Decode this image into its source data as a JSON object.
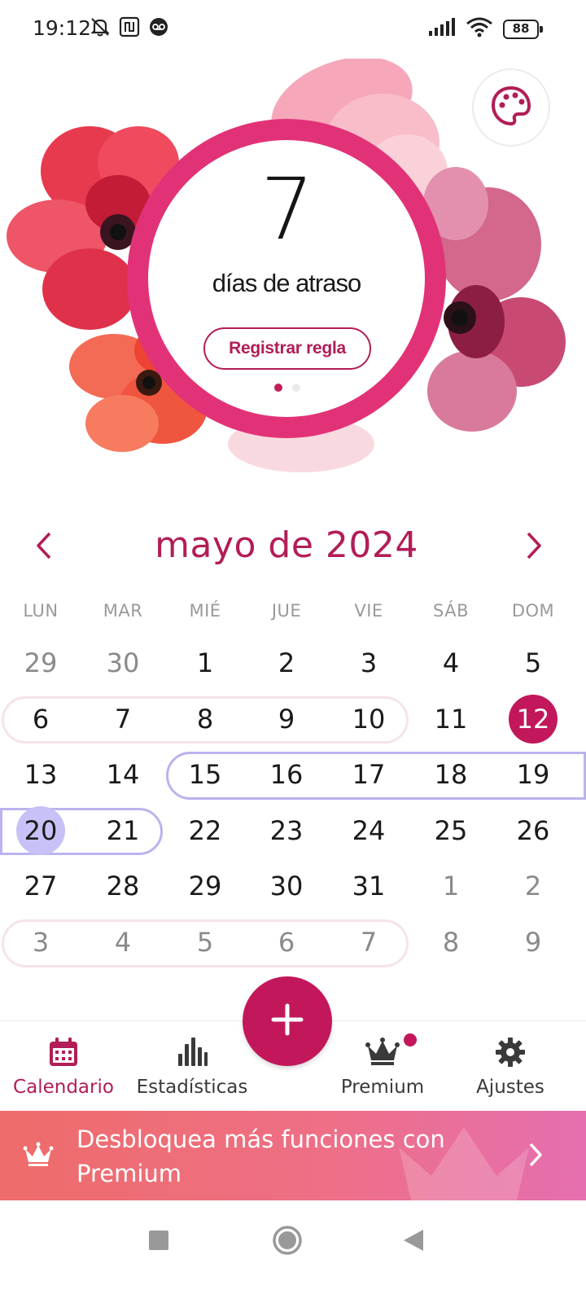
{
  "status_bar": {
    "time": "19:12",
    "battery": "88",
    "icons": [
      "muted-bell-icon",
      "nfc-icon",
      "voicemail-icon",
      "signal-icon",
      "wifi-icon",
      "battery-icon"
    ]
  },
  "hero": {
    "late_days": "7",
    "late_label": "días de atraso",
    "register_button": "Registrar regla",
    "page_count": 2,
    "active_page": 1,
    "ring_color": "#e23277"
  },
  "calendar": {
    "month_title": "mayo de 2024",
    "weekdays": [
      "LUN",
      "MAR",
      "MIÉ",
      "JUE",
      "VIE",
      "SÁB",
      "DOM"
    ],
    "weeks": [
      [
        "29",
        "30",
        "1",
        "2",
        "3",
        "4",
        "5"
      ],
      [
        "6",
        "7",
        "8",
        "9",
        "10",
        "11",
        "12"
      ],
      [
        "13",
        "14",
        "15",
        "16",
        "17",
        "18",
        "19"
      ],
      [
        "20",
        "21",
        "22",
        "23",
        "24",
        "25",
        "26"
      ],
      [
        "27",
        "28",
        "29",
        "30",
        "31",
        "1",
        "2"
      ],
      [
        "3",
        "4",
        "5",
        "6",
        "7",
        "8",
        "9"
      ]
    ],
    "outside_month": [
      [
        0,
        0
      ],
      [
        0,
        1
      ],
      [
        4,
        5
      ],
      [
        4,
        6
      ],
      [
        5,
        0
      ],
      [
        5,
        1
      ],
      [
        5,
        2
      ],
      [
        5,
        3
      ],
      [
        5,
        4
      ],
      [
        5,
        5
      ],
      [
        5,
        6
      ]
    ],
    "highlighted_today": [
      1,
      6
    ],
    "current_day": [
      3,
      0
    ],
    "period_ranges": [
      {
        "week": 1,
        "from": 0,
        "to": 4,
        "color": "#f7e3e8"
      },
      {
        "week": 5,
        "from": 0,
        "to": 4,
        "color": "#f7e3e8"
      }
    ],
    "fertile_ranges": [
      {
        "week": 2,
        "from": 2,
        "to": 6,
        "color": "#bab3ee"
      },
      {
        "week": 3,
        "from": 0,
        "to": 1,
        "color": "#bab3ee"
      }
    ]
  },
  "bottom_nav": [
    {
      "label": "Calendario",
      "icon": "calendar-icon",
      "active": true
    },
    {
      "label": "Estadísticas",
      "icon": "bar-chart-icon",
      "active": false
    },
    {
      "label": "Premium",
      "icon": "crown-icon",
      "active": false,
      "badge": true
    },
    {
      "label": "Ajustes",
      "icon": "gear-icon",
      "active": false
    }
  ],
  "premium_banner": {
    "text": "Desbloquea más funciones con Premium"
  },
  "colors": {
    "accent": "#c2185b",
    "accent_text": "#b21d57",
    "period": "#f7e3e8",
    "fertile": "#bab3ee"
  }
}
